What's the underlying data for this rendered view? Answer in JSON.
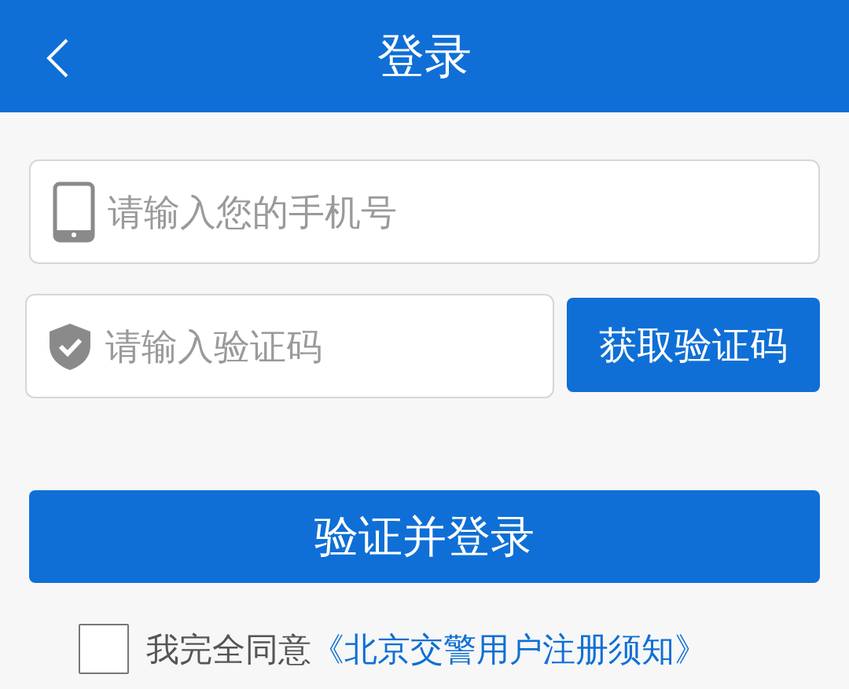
{
  "header": {
    "title": "登录"
  },
  "phone_field": {
    "placeholder": "请输入您的手机号"
  },
  "code_field": {
    "placeholder": "请输入验证码"
  },
  "get_code_button": {
    "label": "获取验证码"
  },
  "login_button": {
    "label": "验证并登录"
  },
  "agreement": {
    "checked": false,
    "text": "我完全同意",
    "link": "《北京交警用户注册须知》"
  }
}
